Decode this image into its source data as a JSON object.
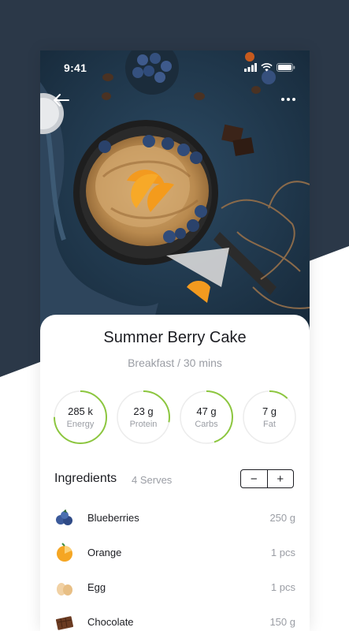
{
  "status_bar": {
    "time": "9:41"
  },
  "recipe": {
    "title": "Summer Berry Cake",
    "subtitle": "Breakfast / 30 mins"
  },
  "nutrition": [
    {
      "value": "285 k",
      "label": "Energy",
      "progress": 0.75
    },
    {
      "value": "23 g",
      "label": "Protein",
      "progress": 0.28
    },
    {
      "value": "47 g",
      "label": "Carbs",
      "progress": 0.45
    },
    {
      "value": "7 g",
      "label": "Fat",
      "progress": 0.12
    }
  ],
  "ingredients": {
    "heading": "Ingredients",
    "serves": "4 Serves",
    "minus_label": "−",
    "plus_label": "+",
    "items": [
      {
        "name": "Blueberries",
        "qty": "250 g",
        "icon": "blueberries-icon"
      },
      {
        "name": "Orange",
        "qty": "1 pcs",
        "icon": "orange-icon"
      },
      {
        "name": "Egg",
        "qty": "1 pcs",
        "icon": "egg-icon"
      },
      {
        "name": "Chocolate",
        "qty": "150 g",
        "icon": "chocolate-icon"
      }
    ]
  },
  "colors": {
    "background_dark": "#2b3848",
    "progress_green": "#8cc63f",
    "track_gray": "#ececec",
    "text_primary": "#1c1d22",
    "text_secondary": "#9a9da4"
  }
}
